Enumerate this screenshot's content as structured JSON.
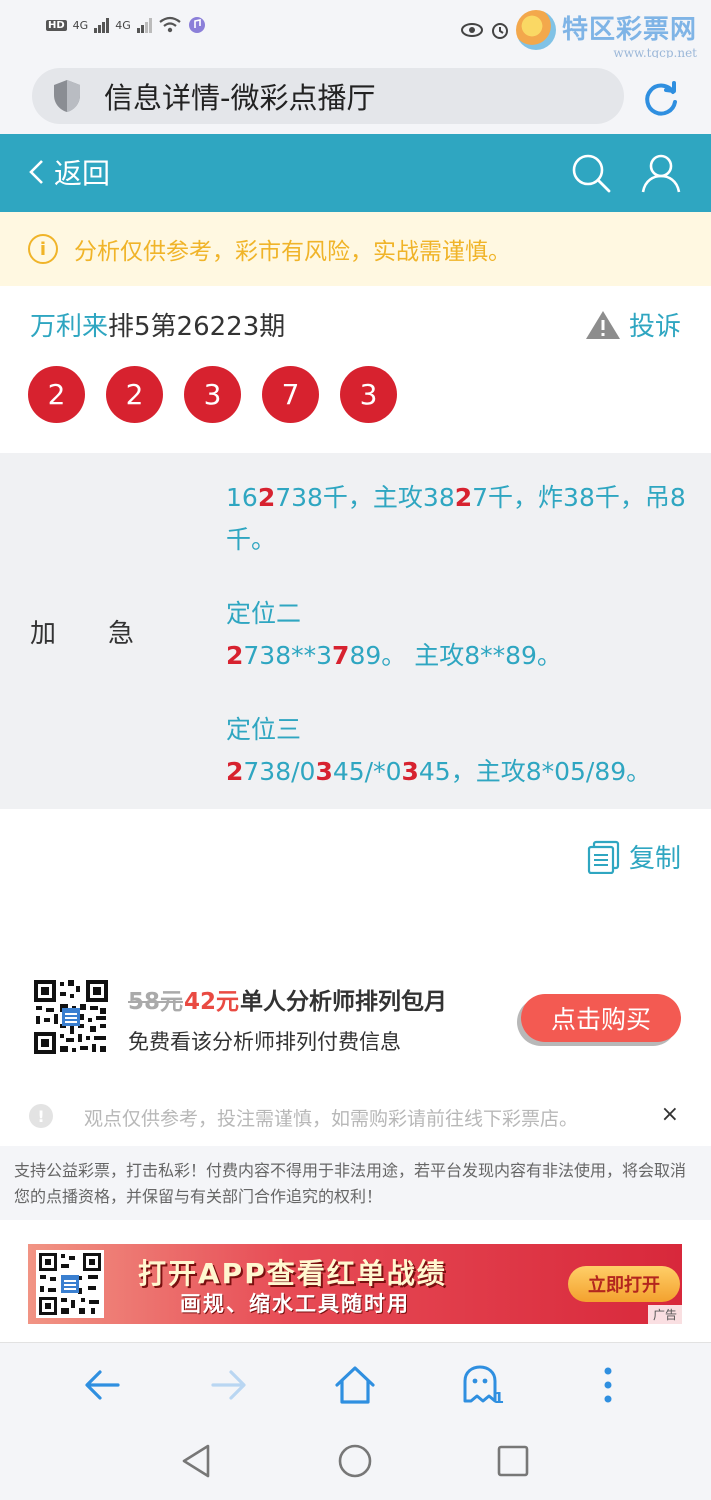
{
  "status_bar": {
    "hd": "HD",
    "net1": "4G",
    "net2": "4G",
    "watermark_text": "特区彩票网",
    "watermark_url": "www.tqcp.net"
  },
  "browser": {
    "page_title": "信息详情-微彩点播厅"
  },
  "header": {
    "back_label": "返回"
  },
  "notice": {
    "text": "分析仅供参考，彩市有风险，实战需谨慎。"
  },
  "post": {
    "analyst": "万利来",
    "issue": "排5第26223期",
    "complain_label": "投诉",
    "balls": [
      "2",
      "2",
      "3",
      "7",
      "3"
    ]
  },
  "content": {
    "label": "加急",
    "p1": {
      "a": "16",
      "h1": "2",
      "b": "738千，主攻38",
      "h2": "2",
      "c": "7千，炸38千，吊8千。"
    },
    "p2": {
      "title": "定位二",
      "h1": "2",
      "a": "738**3",
      "h2": "7",
      "b": "89。 主攻8**89。"
    },
    "p3": {
      "title": "定位三",
      "h1": "2",
      "a": "738/0",
      "h2": "3",
      "b": "45/*0",
      "h3": "3",
      "c": "45，主攻8*05/89。"
    }
  },
  "copy_label": "复制",
  "purchase": {
    "old_price": "58元",
    "new_price": "42元",
    "plan": "单人分析师排列包月",
    "subtitle": "免费看该分析师排列付费信息",
    "buy_label": "点击购买"
  },
  "tip": {
    "text": "观点仅供参考，投注需谨慎，如需购彩请前往线下彩票店。",
    "close": "×"
  },
  "disclaimer": "支持公益彩票，打击私彩！付费内容不得用于非法用途，若平台发现内容有非法使用，将会取消您的点播资格，并保留与有关部门合作追究的权利！",
  "banner": {
    "line1": "打开APP查看红单战绩",
    "line2": "画规、缩水工具随时用",
    "button": "立即打开",
    "ad": "广告"
  },
  "toolbar": {
    "tab_count": "1"
  },
  "colors": {
    "accent": "#2fa6c1",
    "ball": "#d7222f",
    "notice_text": "#f0b429",
    "buy_button": "#f35a52"
  }
}
